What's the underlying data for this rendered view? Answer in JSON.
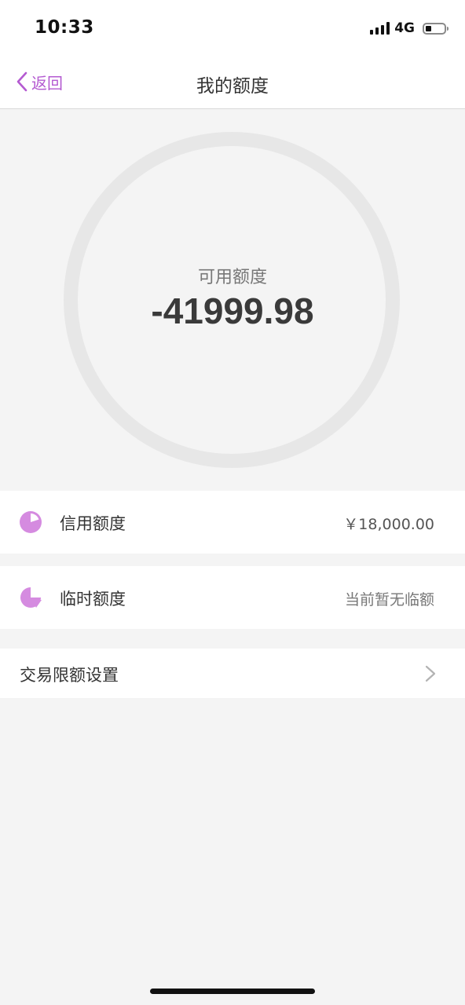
{
  "status_bar": {
    "time": "10:33",
    "network": "4G",
    "signal_icon": "signal-bars",
    "battery_icon": "battery-low",
    "battery_level_fraction": 0.25
  },
  "nav": {
    "back_icon": "chevron-left",
    "back_label": "返回",
    "title": "我的额度"
  },
  "hero": {
    "label": "可用额度",
    "value": "-41999.98"
  },
  "rows": {
    "credit": {
      "icon": "pie-chart",
      "label": "信用额度",
      "value": "￥18,000.00"
    },
    "temporary": {
      "icon": "pie-chart-slice",
      "label": "临时额度",
      "value": "当前暂无临额"
    },
    "limit_settings": {
      "label": "交易限额设置",
      "icon": "chevron-right"
    }
  },
  "colors": {
    "accent": "#b45ad1",
    "icon_fill": "#d58be0",
    "background": "#f4f4f4",
    "ring": "#e7e7e7"
  }
}
